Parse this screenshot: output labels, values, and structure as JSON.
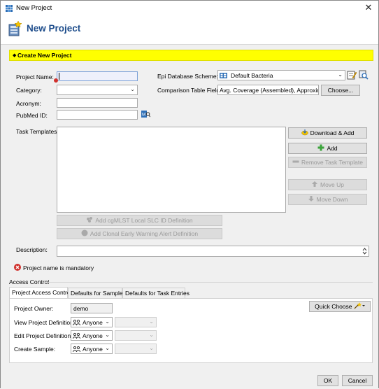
{
  "window": {
    "title": "New Project",
    "close_glyph": "✕"
  },
  "header": {
    "title": "New Project"
  },
  "banner": {
    "text": "Create New Project"
  },
  "form": {
    "project_name_label": "Project Name:",
    "category_label": "Category:",
    "acronym_label": "Acronym:",
    "pubmed_label": "PubMed ID:",
    "task_templates_label": "Task Templates:",
    "description_label": "Description:",
    "epi_db_label": "Epi Database Scheme:",
    "epi_db_value": "Default Bacteria",
    "comparison_label": "Comparison Table Fields:",
    "comparison_value": "Avg. Coverage (Assembled), Approximate",
    "choose_button": "Choose...",
    "download_add_button": "Download & Add",
    "add_button": "Add",
    "remove_template_button": "Remove Task Template",
    "move_up_button": "Move Up",
    "move_down_button": "Move Down",
    "add_cgmlst_button": "Add cgMLST Local SLC ID Definition",
    "add_clonal_button": "Add Clonal Early Warning Alert Definition",
    "error_message": "Project name is mandatory"
  },
  "access": {
    "section_label": "Access Control",
    "tabs": [
      "Project Access Control",
      "Defaults for Samples",
      "Defaults for Task Entries"
    ],
    "quick_choose_button": "Quick Choose",
    "owner_label": "Project Owner:",
    "owner_value": "demo",
    "view_label": "View Project Definition:",
    "edit_label": "Edit Project Definition:",
    "create_label": "Create Sample:",
    "anyone": "Anyone"
  },
  "footer": {
    "ok": "OK",
    "cancel": "Cancel"
  },
  "colors": {
    "banner": "#ffff00",
    "heading": "#1f4e8c",
    "error": "#d0312d"
  }
}
